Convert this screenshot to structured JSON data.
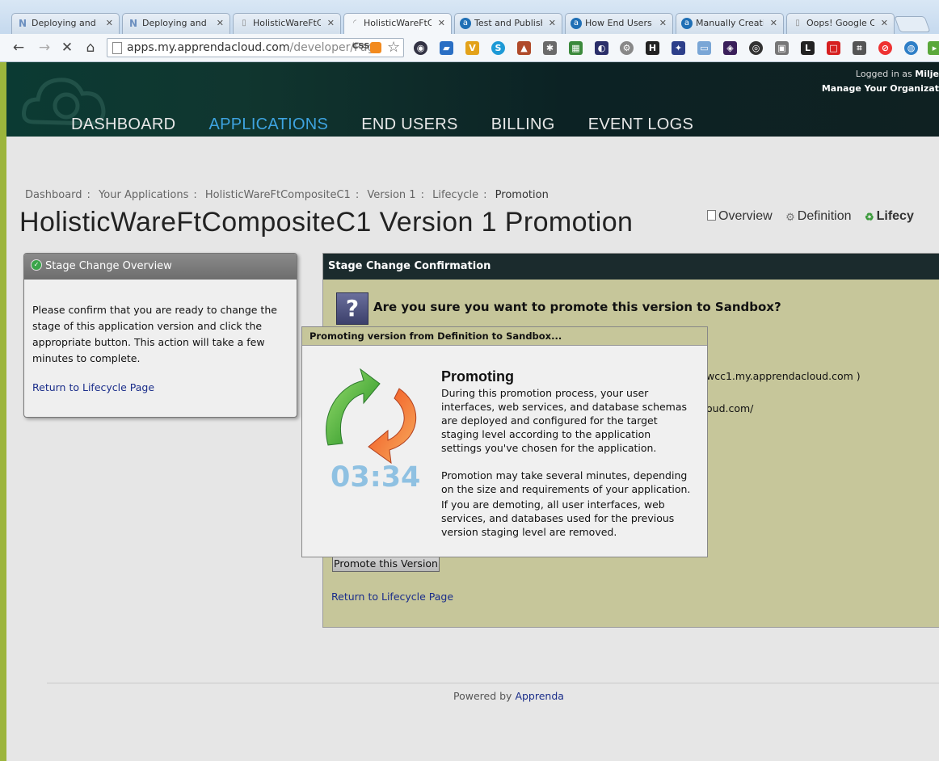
{
  "browser": {
    "tabs": [
      {
        "label": "Deploying and M",
        "icon": "apprenda-n-icon",
        "color": "#6b8fbf"
      },
      {
        "label": "Deploying and M",
        "icon": "apprenda-n-icon",
        "color": "#6b8fbf"
      },
      {
        "label": "HolisticWareFtCo",
        "icon": "page-icon",
        "color": "#888888"
      },
      {
        "label": "HolisticWareFtCo",
        "icon": "loading-icon",
        "color": "#888888"
      },
      {
        "label": "Test and Publish",
        "icon": "apprenda-a-icon",
        "color": "#1f6fb5"
      },
      {
        "label": "How End Users",
        "icon": "apprenda-a-icon",
        "color": "#1f6fb5"
      },
      {
        "label": "Manually Creatin",
        "icon": "apprenda-a-icon",
        "color": "#1f6fb5"
      },
      {
        "label": "Oops! Google Ch",
        "icon": "page-icon",
        "color": "#888888"
      }
    ],
    "url_host": "apps.my.apprendacloud.com",
    "url_path": "/developer/Pag",
    "css_badge": "CSS"
  },
  "header": {
    "logged_in_prefix": "Logged in as",
    "logged_in_user": "Milje",
    "manage_link": "Manage Your Organizat",
    "nav": [
      "DASHBOARD",
      "APPLICATIONS",
      "END USERS",
      "BILLING",
      "EVENT LOGS"
    ],
    "active_nav": "APPLICATIONS"
  },
  "breadcrumb": [
    "Dashboard",
    "Your Applications",
    "HolisticWareFtCompositeC1",
    "Version 1",
    "Lifecycle",
    "Promotion"
  ],
  "page_title": "HolisticWareFtCompositeC1 Version 1 Promotion",
  "subtabs": {
    "overview": "Overview",
    "definition": "Definition",
    "lifecycle": "Lifecy"
  },
  "left_panel": {
    "title": "Stage Change Overview",
    "body": "Please confirm that you are ready to change the stage of this application version and click the appropriate button. This action will take a few minutes to complete.",
    "link": "Return to Lifecycle Page"
  },
  "confirm_panel": {
    "title": "Stage Change Confirmation",
    "question": "Are you sure you want to promote this version to Sandbox?",
    "fragment_1": "wcc1.my.apprendacloud.com )",
    "fragment_2": "oud.com/",
    "button": "Promote this Version",
    "link": "Return to Lifecycle Page"
  },
  "modal": {
    "title": "Promoting version from Definition to Sandbox...",
    "heading": "Promoting",
    "timer": "03:34",
    "para1": "During this promotion process, your user interfaces, web services, and database schemas are deployed and configured for the target staging level according to the application settings you've chosen for the application.",
    "para2": "Promotion may take several minutes, depending on the size and requirements of your application.",
    "para3": "If you are demoting, all user interfaces, web services, and databases used for the previous version staging level are removed."
  },
  "footer": {
    "prefix": "Powered by",
    "link": "Apprenda"
  }
}
